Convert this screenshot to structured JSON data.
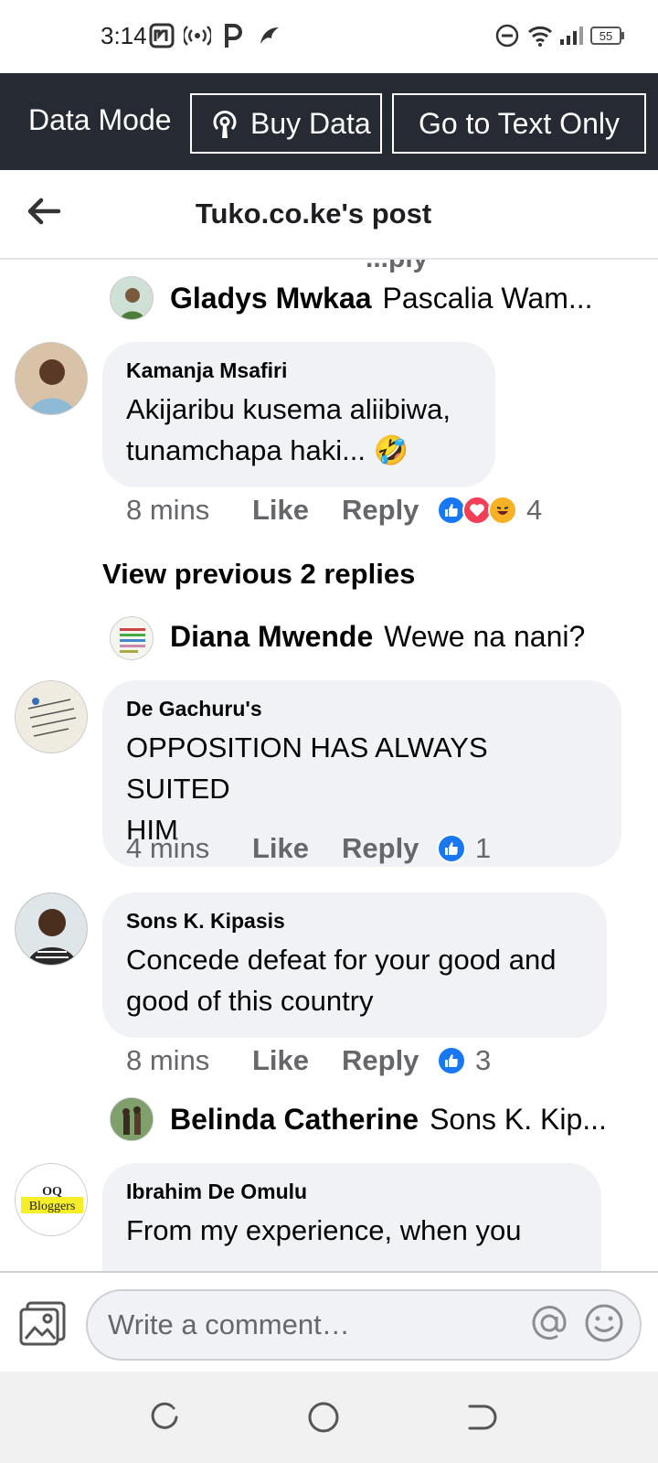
{
  "status_bar": {
    "time": "3:14",
    "battery": "55",
    "icons": [
      "gallery-notification-icon",
      "hotspot-icon",
      "parking-app-icon",
      "bird-app-icon",
      "do-not-disturb-icon",
      "wifi-icon",
      "signal-icon",
      "battery-icon"
    ]
  },
  "data_bar": {
    "mode_label": "Data Mode",
    "buy_data_label": "Buy Data",
    "text_only_label": "Go to Text Only",
    "background": "#252a33"
  },
  "header": {
    "title": "Tuko.co.ke's post"
  },
  "comments": {
    "clipped_top_text": "...ply",
    "reply_gladys": {
      "name": "Gladys Mwkaa",
      "text": "Pascalia Wam..."
    },
    "kamanja": {
      "author": "Kamanja Msafiri",
      "line1": "Akijaribu kusema aliibiwa,",
      "line2": "tunamchapa haki... 🤣",
      "time": "8 mins",
      "like": "Like",
      "reply": "Reply",
      "reaction_count": "4"
    },
    "view_previous": "View previous 2 replies",
    "reply_diana": {
      "name": "Diana Mwende",
      "text": "Wewe na nani?"
    },
    "degachuru": {
      "author": "De Gachuru's",
      "line1": "OPPOSITION HAS ALWAYS SUITED",
      "line2": "HIM",
      "time": "4 mins",
      "like": "Like",
      "reply": "Reply",
      "reaction_count": "1"
    },
    "sons": {
      "author": "Sons K. Kipasis",
      "line1": "Concede defeat for your good and",
      "line2": "good of this country",
      "time": "8 mins",
      "like": "Like",
      "reply": "Reply",
      "reaction_count": "3"
    },
    "reply_belinda": {
      "name": "Belinda Catherine",
      "text": "Sons K. Kip..."
    },
    "ibrahim": {
      "author": "Ibrahim De Omulu",
      "line1": "From my experience, when you",
      "avatar_text_1": "OQ",
      "avatar_text_2": "Bloggers"
    }
  },
  "composer": {
    "placeholder": "Write a comment…"
  },
  "colors": {
    "like_blue": "#1877f2",
    "love_red": "#f33e58",
    "haha_yellow": "#f7b125",
    "bubble_gray": "#f0f2f5",
    "secondary_text": "#65676b"
  }
}
